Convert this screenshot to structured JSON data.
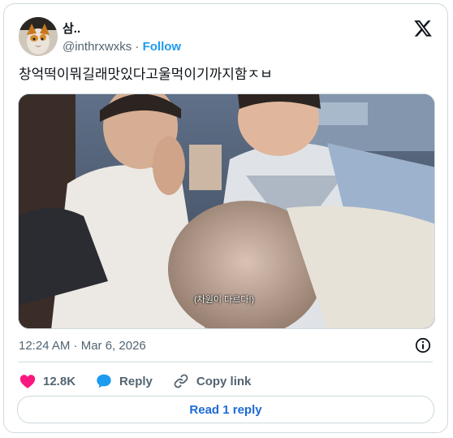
{
  "author": {
    "name": "삼..",
    "handle": "@inthrxwxks",
    "separator": "·",
    "follow_label": "Follow"
  },
  "tweet": {
    "text": "창억떡이뭐길래맛있다고울먹이기까지함ㅈㅂ",
    "video_caption": "(차원이 다르다!)",
    "timestamp": "12:24 AM · Mar 6, 2026"
  },
  "actions": {
    "likes": "12.8K",
    "reply_label": "Reply",
    "copy_link_label": "Copy link"
  },
  "footer": {
    "read_replies_label": "Read 1 reply"
  },
  "colors": {
    "accent": "#1d9bf0",
    "like": "#f91880",
    "reply_icon": "#1d9bf0",
    "muted": "#536471",
    "border": "#cfd9de"
  },
  "icons": [
    "x-logo-icon",
    "info-icon",
    "heart-icon",
    "speech-bubble-icon",
    "link-icon"
  ]
}
